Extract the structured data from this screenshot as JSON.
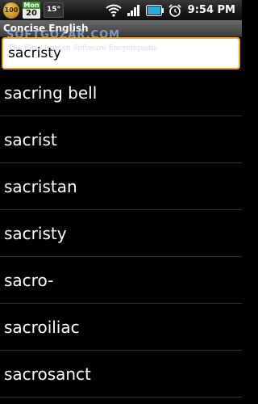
{
  "status_bar": {
    "app_badge": "100",
    "calendar_day": "Mon",
    "calendar_date": "20",
    "temperature": "15°",
    "time": "9:54 PM",
    "icons": [
      "wifi-icon",
      "signal-icon",
      "battery-icon",
      "alarm-icon"
    ]
  },
  "titlebar": {
    "title": "Concise English"
  },
  "watermark": {
    "line1": "SOFTGOZAR.COM",
    "line2": "The First Iranian Software Encyclopedia"
  },
  "search": {
    "value": "sacristy"
  },
  "results": [
    "sacring bell",
    "sacrist",
    "sacristan",
    "sacristy",
    "sacro-",
    "sacroiliac",
    "sacrosanct"
  ],
  "colors": {
    "background": "#000000",
    "focus_border": "#e7a32a",
    "battery": "#2aa9e0"
  }
}
